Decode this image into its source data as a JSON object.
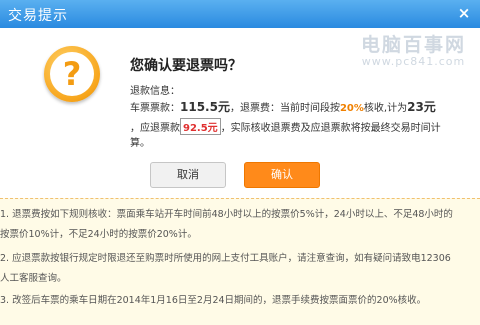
{
  "window": {
    "title": "交易提示",
    "close_symbol": "×"
  },
  "watermark": {
    "line1": "电脑百事网",
    "line2": "www.pc841.com"
  },
  "icon": {
    "name": "question-warning-icon",
    "glyph": "?"
  },
  "dialog": {
    "question": "您确认要退票吗？",
    "refund_info_label": "退款信息：",
    "ticket_price_label": "车票票款：",
    "ticket_price": "115.5元",
    "fee_label": "，退票费：",
    "fee_note_prefix": "当前时间段按",
    "fee_percent": "20%",
    "fee_note_middle": "核收,计为",
    "fee_amount": "23元",
    "refund_prefix": "，应退票款",
    "refund_amount": "92.5元",
    "refund_note": "，实际核收退票费及应退票款将按最终交易时间计",
    "refund_note_end": "算。"
  },
  "buttons": {
    "cancel_label": "取消",
    "ok_label": "确认"
  },
  "notes": {
    "n1_line1": "1. 退票费按如下规则核收：票面乘车站开车时间前48小时以上的按票价5%计，24小时以上、不足48小时的",
    "n1_line2": "按票价10%计，不足24小时的按票价20%计。",
    "n2_line1": "2. 应退票款按银行规定时限退还至购票时所使用的网上支付工具账户，请注意查询，如有疑问请致电12306",
    "n2_line2": "人工客服查询。",
    "n3_line1": "3. 改签后车票的乘车日期在2014年1月16日至2月24日期间的，退票手续费按票面票价的20%核收。"
  },
  "colors": {
    "titlebar": "#2a8ae0",
    "accent": "#ff8a1a",
    "notes_bg": "#fffbe7"
  }
}
